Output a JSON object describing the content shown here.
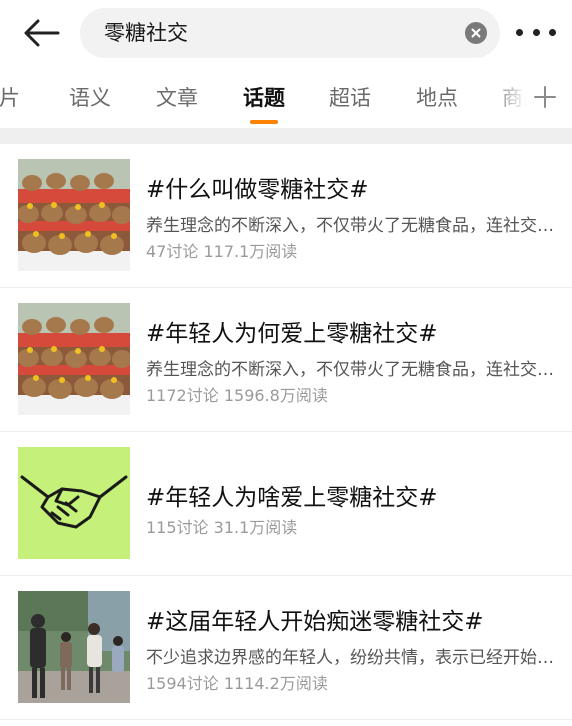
{
  "search": {
    "query": "零糖社交"
  },
  "icons": {
    "back": "arrow-left-icon",
    "clear": "close-circle-icon",
    "more": "more-dots-icon",
    "add": "plus-icon"
  },
  "tabs": [
    {
      "label": "图片"
    },
    {
      "label": "语义"
    },
    {
      "label": "文章"
    },
    {
      "label": "话题",
      "active": true
    },
    {
      "label": "超话"
    },
    {
      "label": "地点"
    },
    {
      "label": "商品"
    }
  ],
  "colors": {
    "accent": "#ff8200",
    "thumb_green": "#c5f07a"
  },
  "topics": [
    {
      "title": "#什么叫做零糖社交#",
      "description": "养生理念的不断深入，不仅带火了无糖食品，连社交方式也变了",
      "discussions": "47讨论",
      "reads": "117.1万阅读",
      "image": "capybara-plush-photo"
    },
    {
      "title": "#年轻人为何爱上零糖社交#",
      "description": "养生理念的不断深入，不仅带火了无糖食品，连社交方式也变了",
      "discussions": "1172讨论",
      "reads": "1596.8万阅读",
      "image": "capybara-plush-photo"
    },
    {
      "title": "#年轻人为啥爱上零糖社交#",
      "description": "",
      "discussions": "115讨论",
      "reads": "31.1万阅读",
      "image": "handshake-illustration"
    },
    {
      "title": "#这届年轻人开始痴迷零糖社交#",
      "description": "不少追求边界感的年轻人，纷纷共情，表示已经开始零糖社交",
      "discussions": "1594讨论",
      "reads": "1114.2万阅读",
      "image": "people-outdoor-photo"
    }
  ]
}
